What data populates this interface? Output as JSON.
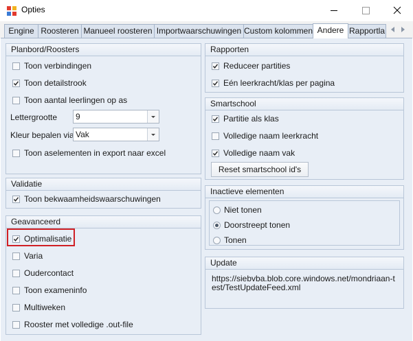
{
  "window": {
    "title": "Opties"
  },
  "tabs": [
    {
      "label": "Engine"
    },
    {
      "label": "Roosteren"
    },
    {
      "label": "Manueel roosteren"
    },
    {
      "label": "Importwaarschuwingen"
    },
    {
      "label": "Custom kolommen"
    },
    {
      "label": "Andere",
      "active": true
    },
    {
      "label": "Rapportla"
    }
  ],
  "planbord": {
    "title": "Planbord/Roosters",
    "toon_verbindingen": {
      "label": "Toon verbindingen",
      "checked": false
    },
    "toon_detailstrook": {
      "label": "Toon detailstrook",
      "checked": true
    },
    "toon_aantal": {
      "label": "Toon aantal leerlingen op as",
      "checked": false
    },
    "lettergrootte": {
      "label": "Lettergrootte",
      "value": "9"
    },
    "kleur": {
      "label": "Kleur bepalen via",
      "value": "Vak"
    },
    "toon_aselementen": {
      "label": "Toon aselementen in export naar excel",
      "checked": false
    }
  },
  "validatie": {
    "title": "Validatie",
    "bekwaamheid": {
      "label": "Toon bekwaamheidswaarschuwingen",
      "checked": true
    }
  },
  "geavanceerd": {
    "title": "Geavanceerd",
    "items": [
      {
        "label": "Optimalisatie",
        "checked": true
      },
      {
        "label": "Varia",
        "checked": false
      },
      {
        "label": "Oudercontact",
        "checked": false
      },
      {
        "label": "Toon exameninfo",
        "checked": false
      },
      {
        "label": "Multiweken",
        "checked": false
      },
      {
        "label": "Rooster met volledige .out-file",
        "checked": false
      }
    ]
  },
  "rapporten": {
    "title": "Rapporten",
    "items": [
      {
        "label": "Reduceer partities",
        "checked": true
      },
      {
        "label": "Eén leerkracht/klas per pagina",
        "checked": true
      }
    ]
  },
  "smartschool": {
    "title": "Smartschool",
    "items": [
      {
        "label": "Partitie als klas",
        "checked": true
      },
      {
        "label": "Volledige naam leerkracht",
        "checked": false
      },
      {
        "label": "Volledige naam vak",
        "checked": true
      }
    ],
    "reset_button": "Reset smartschool id's"
  },
  "inactieve": {
    "title": "Inactieve elementen",
    "options": [
      {
        "label": "Niet tonen",
        "selected": false
      },
      {
        "label": "Doorstreept tonen",
        "selected": true
      },
      {
        "label": "Tonen",
        "selected": false
      }
    ]
  },
  "update": {
    "title": "Update",
    "url_line1": "https://siebvba.blob.core.windows.net/mondriaan-t",
    "url_line2": "est/TestUpdateFeed.xml"
  },
  "colors": {
    "highlight": "#d01f24",
    "panel": "#e8eef6"
  }
}
